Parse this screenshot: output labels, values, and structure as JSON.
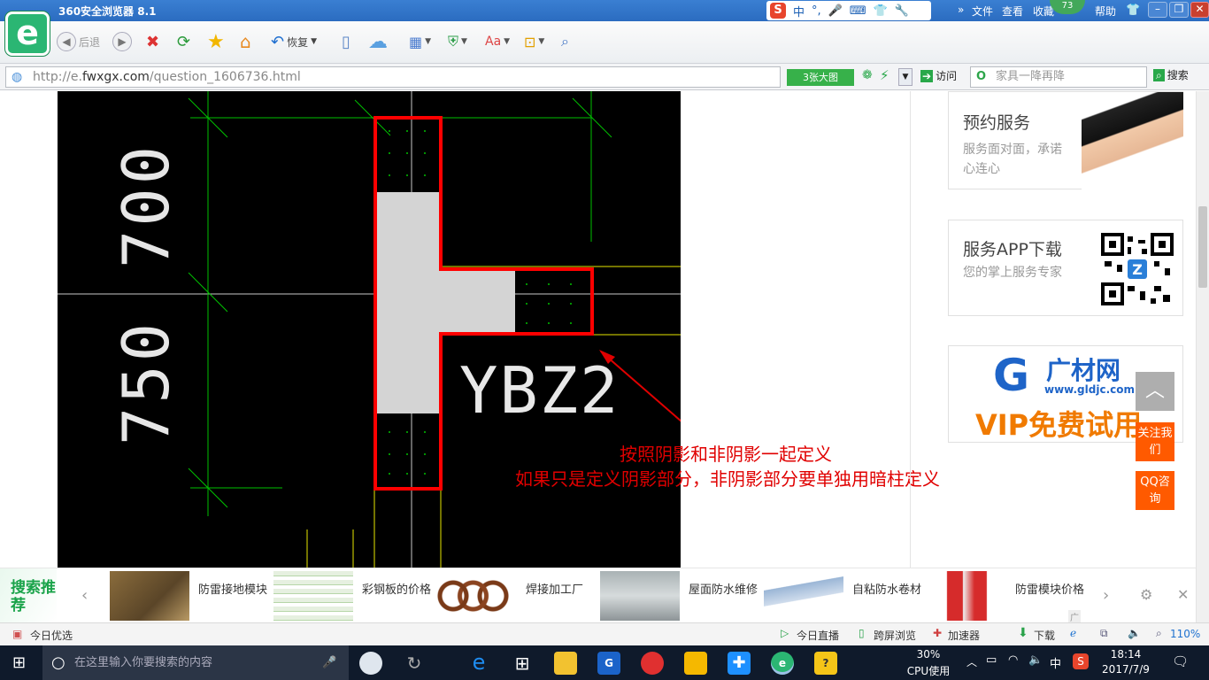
{
  "browser": {
    "title": "360安全浏览器 8.1",
    "menu": [
      "文件",
      "查看",
      "收藏",
      "帮助"
    ],
    "badge": "73",
    "window_controls": [
      "minimize",
      "maximize",
      "close"
    ],
    "ime": {
      "logo": "S",
      "lang": "中"
    },
    "toolbar": {
      "back": "后退",
      "restore": "恢复"
    },
    "address": {
      "scheme": "http://e.",
      "domain": "fwxgx.com",
      "path": "/question_1606736.html"
    },
    "bigimage": "3张大图",
    "visit": "访问",
    "search_placeholder": "家具一降再降",
    "search_button": "搜索"
  },
  "page": {
    "cad": {
      "dim_top": "700",
      "dim_bottom": "750",
      "label": "YBZ2",
      "colors": {
        "bg": "#000000",
        "outline": "#ff0000",
        "grid": "#00c000",
        "axis": "#c8c8c8",
        "yellow": "#e6e600",
        "fill": "#d4d4d4"
      }
    },
    "annotation_line1": "按照阴影和非阴影一起定义",
    "annotation_line2": "如果只是定义阴影部分，非阴影部分要单独用暗柱定义",
    "sidebar": {
      "card1": {
        "title": "预约服务",
        "sub": "服务面对面，承诺心连心"
      },
      "card2": {
        "title": "服务APP下载",
        "sub": "您的掌上服务专家"
      },
      "card3": {
        "brand": "广材网",
        "url": "www.gldjc.com",
        "slogan": "VIP免费试用"
      },
      "follow": "关注我们",
      "qq": "QQ咨询"
    }
  },
  "bottom_bar": {
    "label": "搜索推荐",
    "items": [
      {
        "text": "防雷接地模块"
      },
      {
        "text": "彩钢板的价格"
      },
      {
        "text": "焊接加工厂"
      },
      {
        "text": "屋面防水维修"
      },
      {
        "text": "自粘防水卷材"
      },
      {
        "text": "防雷模块价格"
      }
    ],
    "ad": "广告"
  },
  "statusbar": {
    "left": "今日优选",
    "items": [
      "今日直播",
      "跨屏浏览",
      "加速器",
      "下载"
    ],
    "zoom": "110%"
  },
  "taskbar": {
    "search_placeholder": "在这里输入你要搜索的内容",
    "cpu_percent": "30%",
    "cpu_label": "CPU使用",
    "ime": "中",
    "time": "18:14",
    "date": "2017/7/9"
  }
}
